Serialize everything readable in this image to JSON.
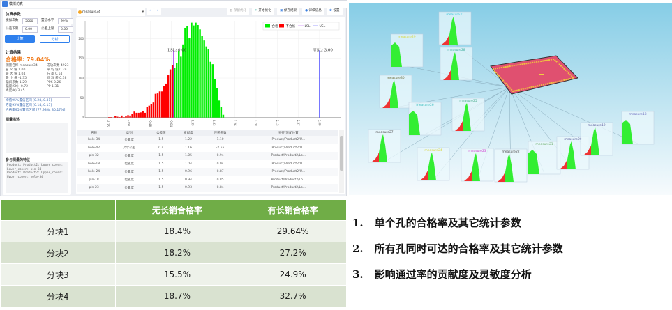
{
  "window": {
    "title": "模拟仿真"
  },
  "params": {
    "title": "仿真参数",
    "fields": [
      {
        "label": "模拟次数",
        "value": "5000"
      },
      {
        "label": "置信水平",
        "value": "99%"
      },
      {
        "label": "公差下限",
        "value": "0.00"
      },
      {
        "label": "公差上限",
        "value": "3.00"
      }
    ],
    "calc": "计算",
    "analyze": "分析"
  },
  "results": {
    "title": "计算结果",
    "rate": "合格率: 79.04%",
    "left": [
      [
        "测量名称",
        "measure34"
      ],
      [
        "名 义 值",
        "1.00"
      ],
      [
        "最 大 值",
        "1.04"
      ],
      [
        "最 小 值",
        "-1.35"
      ],
      [
        "偏斜系数",
        "1.29"
      ],
      [
        "偏度(SK)",
        "-0.72"
      ],
      [
        "峰度(K)",
        "3.45"
      ]
    ],
    "right": [
      [
        "成功次数",
        "4923"
      ],
      [
        "平 均 值",
        "0.29"
      ],
      [
        "方    差",
        "0.14"
      ],
      [
        "标 准 差",
        "0.38"
      ],
      [
        "PPK",
        "0.26"
      ],
      [
        "PP",
        "1.31"
      ]
    ],
    "intervals": [
      "均值95%置信区间 [0.28, 0.31]",
      "方差95%置信区间 [0.14, 0.15]",
      "合格率95%置信区间 [77.93%, 80.17%]"
    ]
  },
  "desc": {
    "title": "测量描述"
  },
  "features": {
    "title": "参与测量的特征",
    "text": "Product: Product2: Lower_cover:\nLower_cover: pin-34\nProduct: Product2: Upper_cover:\nUpper_cover: hole-34"
  },
  "toolbar": {
    "measure": "measure34",
    "prev": "‹",
    "next": "›",
    "keep": "保留优化",
    "start": "开始优化",
    "save": "保存结果",
    "detail": "详细信息",
    "settings": "设置"
  },
  "chart_data": {
    "type": "bar",
    "xlim": [
      -1.35,
      3.0
    ],
    "ylim": [
      0,
      240
    ],
    "yticks": [
      0,
      50,
      100,
      150,
      200
    ],
    "xticks": [
      "-1.35",
      "-0.91",
      "-0.48",
      "-0.04",
      "0.39",
      "0.83",
      "1.26",
      "1.70",
      "2.13",
      "2.57",
      "3.00"
    ],
    "bin_start": -1.35,
    "bin_width": 0.0435,
    "fail_values": [
      1,
      1,
      0,
      3,
      2,
      1,
      5,
      1,
      4,
      6,
      5,
      10,
      15,
      12,
      12,
      13,
      17,
      12,
      27,
      30,
      34,
      38,
      60,
      61,
      66,
      66,
      79,
      86,
      107,
      122,
      132
    ],
    "pass_values": [
      126,
      138,
      169,
      154,
      185,
      227,
      232,
      202,
      240,
      233,
      240,
      234,
      223,
      207,
      195,
      180,
      173,
      141,
      135,
      97,
      74,
      43,
      27,
      7
    ],
    "lsl": {
      "value": 0.0,
      "label": "LSL: 0.00"
    },
    "usl": {
      "value": 3.0,
      "label": "USL: 3.00"
    },
    "legend": [
      {
        "name": "合格",
        "color": "#00ee00"
      },
      {
        "name": "不合格",
        "color": "#ff0000"
      },
      {
        "name": "LSL",
        "color": "#a020f0"
      },
      {
        "name": "USL",
        "color": "#2020ff"
      }
    ],
    "legend_position": "top-right",
    "grid": true
  },
  "contrib_table": {
    "headers": [
      "名称",
      "类别",
      "公差值",
      "贡献度",
      "传递系数",
      "特征/装配位置"
    ],
    "rows": [
      [
        "hole-34",
        "位置度",
        "1.5",
        "1.22",
        "1.10",
        "Product/Product2/U..."
      ],
      [
        "hole-42",
        "尺寸公差",
        "0.4",
        "1.16",
        "-2.55",
        "Product/Product2/U..."
      ],
      [
        "pin-32",
        "位置度",
        "1.5",
        "1.05",
        "0.94",
        "Product/Product2/Lo..."
      ],
      [
        "hole-18",
        "位置度",
        "1.5",
        "1.04",
        "0.94",
        "Product/Product2/U..."
      ],
      [
        "hole-24",
        "位置度",
        "1.5",
        "0.96",
        "0.87",
        "Product/Product2/U..."
      ],
      [
        "pin-18",
        "位置度",
        "1.5",
        "0.94",
        "0.85",
        "Product/Product2/Lo..."
      ],
      [
        "pin-23",
        "位置度",
        "1.5",
        "0.93",
        "0.84",
        "Product/Product2/Lo..."
      ]
    ]
  },
  "scene": {
    "panels": [
      {
        "label": "measure31",
        "color": "#40c8d8"
      },
      {
        "label": "measure29",
        "color": "#d8d840"
      },
      {
        "label": "measure28",
        "color": "#40b0a0"
      },
      {
        "label": "measure30",
        "color": "#707040"
      },
      {
        "label": "measure26",
        "color": "#40c0c0"
      },
      {
        "label": "measure25",
        "color": "#50b090"
      },
      {
        "label": "measure27",
        "color": "#505050"
      },
      {
        "label": "measure24",
        "color": "#d8d840"
      },
      {
        "label": "measure23",
        "color": "#d040d0"
      },
      {
        "label": "measure22",
        "color": "#505050"
      },
      {
        "label": "measure21",
        "color": "#70b070"
      },
      {
        "label": "measure20",
        "color": "#6060a0"
      },
      {
        "label": "measure19",
        "color": "#6060a0"
      },
      {
        "label": "measure18",
        "color": "#7070c0"
      }
    ]
  },
  "summary_table": {
    "headers": [
      "",
      "无长销合格率",
      "有长销合格率"
    ],
    "rows": [
      [
        "分块1",
        "18.4%",
        "29.64%"
      ],
      [
        "分块2",
        "18.2%",
        "27.2%"
      ],
      [
        "分块3",
        "15.5%",
        "24.9%"
      ],
      [
        "分块4",
        "18.7%",
        "32.7%"
      ]
    ]
  },
  "list": [
    {
      "num": "1.",
      "text": "单个孔的合格率及其它统计参数"
    },
    {
      "num": "2.",
      "text": "所有孔同时可达的合格率及其它统计参数"
    },
    {
      "num": "3.",
      "text": "影响通过率的贡献度及灵敏度分析"
    }
  ]
}
